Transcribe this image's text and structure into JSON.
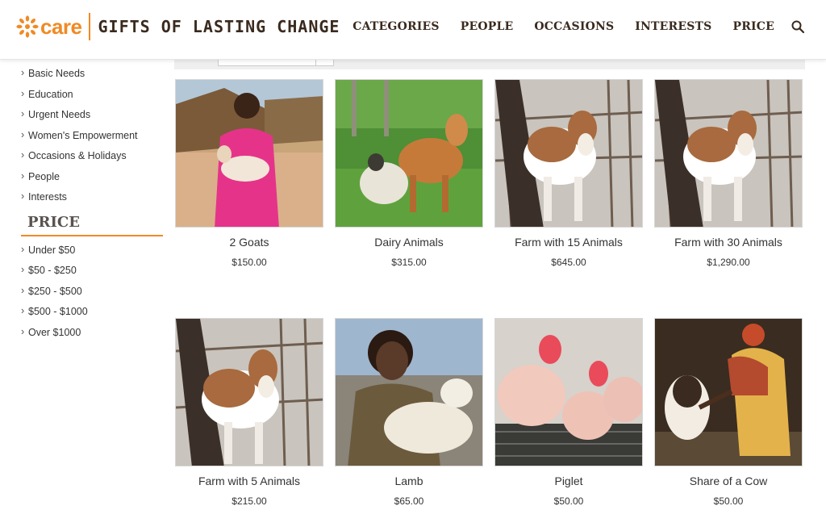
{
  "brand": {
    "logo_text": "care",
    "tagline": "GIFTS OF LASTING CHANGE",
    "accent": "#f08a24"
  },
  "nav": {
    "items": [
      {
        "label": "CATEGORIES"
      },
      {
        "label": "PEOPLE"
      },
      {
        "label": "OCCASIONS"
      },
      {
        "label": "INTERESTS"
      },
      {
        "label": "PRICE"
      }
    ],
    "search_icon": "search-icon"
  },
  "sidebar": {
    "category_links": [
      {
        "label": "Basic Needs"
      },
      {
        "label": "Education"
      },
      {
        "label": "Urgent Needs"
      },
      {
        "label": "Women's Empowerment"
      },
      {
        "label": "Occasions & Holidays"
      },
      {
        "label": "People"
      },
      {
        "label": "Interests"
      }
    ],
    "price_heading": "PRICE",
    "price_links": [
      {
        "label": "Under $50"
      },
      {
        "label": "$50 - $250"
      },
      {
        "label": "$250 - $500"
      },
      {
        "label": "$500 - $1000"
      },
      {
        "label": "Over $1000"
      }
    ]
  },
  "products": [
    {
      "title": "2 Goats",
      "price": "$150.00",
      "image": "girl-with-goat"
    },
    {
      "title": "Dairy Animals",
      "price": "$315.00",
      "image": "cow-and-sheep"
    },
    {
      "title": "Farm with 15 Animals",
      "price": "$645.00",
      "image": "calf-in-pen"
    },
    {
      "title": "Farm with 30 Animals",
      "price": "$1,290.00",
      "image": "calf-in-pen"
    },
    {
      "title": "Farm with 5 Animals",
      "price": "$215.00",
      "image": "calf-in-pen"
    },
    {
      "title": "Lamb",
      "price": "$65.00",
      "image": "woman-with-lamb"
    },
    {
      "title": "Piglet",
      "price": "$50.00",
      "image": "piglets"
    },
    {
      "title": "Share of a Cow",
      "price": "$50.00",
      "image": "woman-feeding-calf"
    }
  ]
}
